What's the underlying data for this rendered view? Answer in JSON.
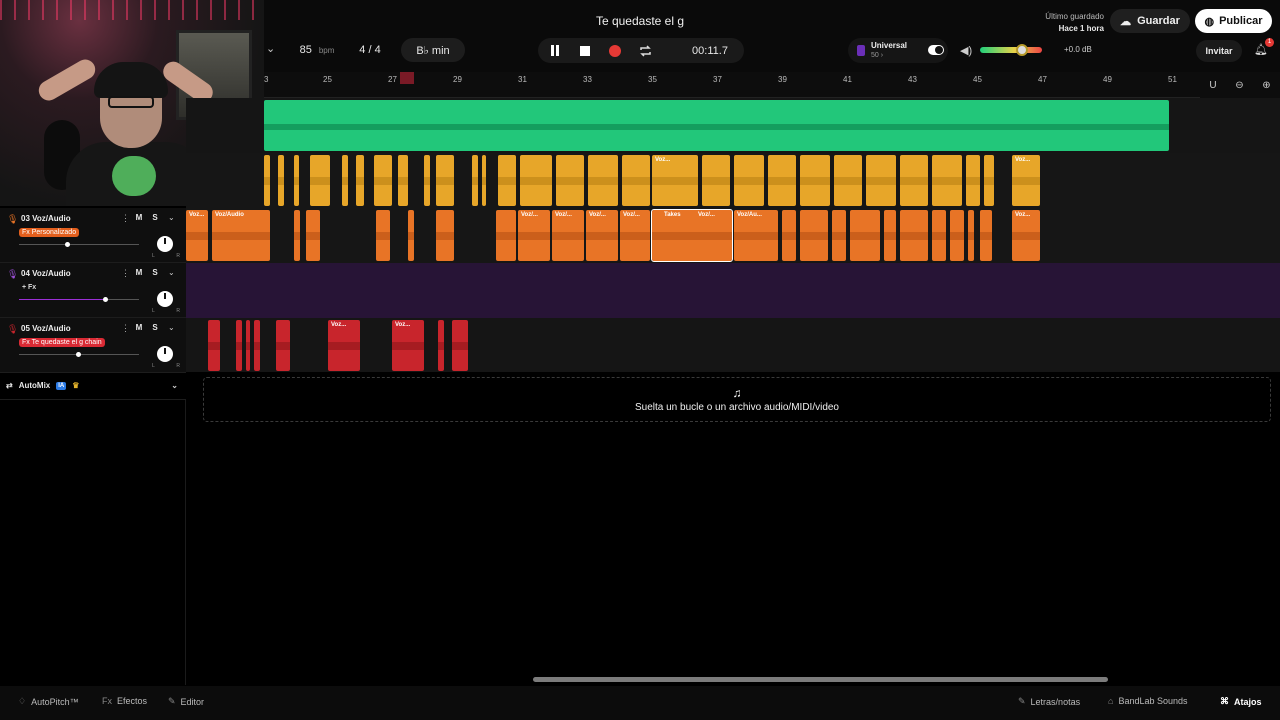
{
  "header": {
    "song_title": "Te quedaste el g",
    "last_saved_label": "Último guardado",
    "last_saved_when": "Hace 1 hora",
    "save_label": "Guardar",
    "publish_label": "Publicar",
    "invite_label": "Invitar",
    "notification_count": "1"
  },
  "controls": {
    "bpm": "85",
    "bpm_unit": "bpm",
    "time_sig": "4 / 4",
    "key": "B♭ min",
    "time": "00:11.7",
    "vibe_name": "Universal",
    "vibe_level": "50 ›",
    "volume_db": "+0.0 dB",
    "volume_level_fraction": 0.6
  },
  "ruler": {
    "ticks": [
      "3",
      "25",
      "27",
      "29",
      "31",
      "33",
      "35",
      "37",
      "39",
      "41",
      "43",
      "45",
      "47",
      "49",
      "51"
    ]
  },
  "tracks": [
    {
      "number": "03",
      "name": "03  Voz/Audio",
      "fx": "Fx  Personalizado",
      "fx_style": "orange",
      "volume_fraction": 0.4,
      "color": "#e87426",
      "clip_labels": [
        "Voz...",
        "Voz/Audio",
        "Voz/...",
        "Voz/...",
        "Voz/...",
        "Voz/...",
        "Takes",
        "Voz/...",
        "Voz/Au...",
        "Voz..."
      ]
    },
    {
      "number": "04",
      "name": "04  Voz/Audio",
      "fx": "+ Fx",
      "fx_style": "plain",
      "volume_fraction": 0.72,
      "color": "#7b2fbe",
      "clip_labels": []
    },
    {
      "number": "05",
      "name": "05  Voz/Audio",
      "fx": "Fx  Te quedaste el g chain",
      "fx_style": "red",
      "volume_fraction": 0.5,
      "color": "#c8252c",
      "clip_labels": [
        "Voz...",
        "Voz..."
      ]
    }
  ],
  "yellow_clip_labels": [
    "Voz...",
    "Voz..."
  ],
  "pan_labels": {
    "left": "L",
    "right": "R"
  },
  "automix": {
    "label": "AutoMix",
    "badge": "IA"
  },
  "dropzone": {
    "text": "Suelta un bucle o un archivo audio/MIDI/video"
  },
  "bottom": {
    "autopitch": "AutoPitch™",
    "effects": "Efectos",
    "editor": "Editor",
    "lyrics": "Letras/notas",
    "sounds": "BandLab Sounds",
    "shortcuts": "Atajos"
  },
  "colors": {
    "green_track": "#22c77a",
    "yellow_track": "#e7a629",
    "orange_track": "#e87426",
    "purple_track": "#271436",
    "red_track": "#c8252c",
    "record": "#e53935"
  }
}
